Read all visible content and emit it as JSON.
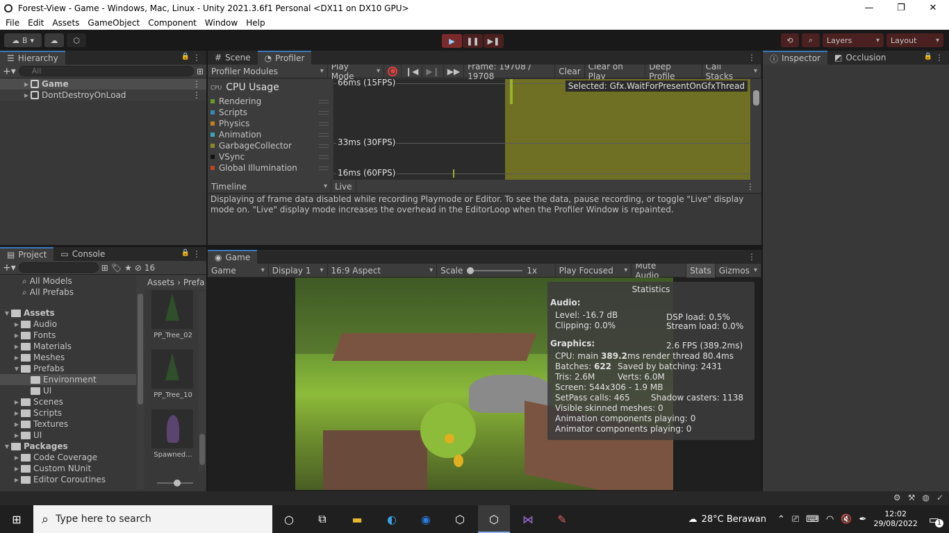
{
  "window": {
    "title": "Forest-View - Game - Windows, Mac, Linux - Unity 2021.3.6f1 Personal <DX11 on DX10 GPU>",
    "minimize": "—",
    "maximize": "❐",
    "close": "✕"
  },
  "menu": [
    "File",
    "Edit",
    "Assets",
    "GameObject",
    "Component",
    "Window",
    "Help"
  ],
  "toolbar": {
    "account": "B",
    "layers": "Layers",
    "layout": "Layout"
  },
  "hierarchy": {
    "tab": "Hierarchy",
    "search_placeholder": "All",
    "items": [
      {
        "label": "Game",
        "selected": true
      },
      {
        "label": "DontDestroyOnLoad",
        "selected": false
      }
    ]
  },
  "scene_tab": "Scene",
  "profiler": {
    "tab": "Profiler",
    "modules": "Profiler Modules",
    "play_mode": "Play Mode",
    "frame": "Frame: 19708 / 19708",
    "clear": "Clear",
    "clear_on_play": "Clear on Play",
    "deep_profile": "Deep Profile",
    "call_stacks": "Call Stacks",
    "cpu_title": "CPU Usage",
    "legend": [
      {
        "label": "Rendering",
        "color": "#6b9a27"
      },
      {
        "label": "Scripts",
        "color": "#3a87b8"
      },
      {
        "label": "Physics",
        "color": "#c6811e"
      },
      {
        "label": "Animation",
        "color": "#3aa5b8"
      },
      {
        "label": "GarbageCollector",
        "color": "#8a8a2a"
      },
      {
        "label": "VSync",
        "color": "#111111"
      },
      {
        "label": "Global Illumination",
        "color": "#b8461e"
      }
    ],
    "grid_labels": [
      "66ms (15FPS)",
      "33ms (30FPS)",
      "16ms (60FPS)"
    ],
    "selected": "Selected: Gfx.WaitForPresentOnGfxThread",
    "timeline": "Timeline",
    "live": "Live",
    "message": "Displaying of frame data disabled while recording Playmode or Editor. To see the data, pause recording, or toggle \"Live\" display mode on. \"Live\" display mode increases the overhead in the EditorLoop when the Profiler Window is repainted."
  },
  "inspector": {
    "tab": "Inspector",
    "occlusion_tab": "Occlusion"
  },
  "project": {
    "tab": "Project",
    "console_tab": "Console",
    "hidden_count": "16",
    "favorites": [
      "All Models",
      "All Prefabs"
    ],
    "tree": [
      {
        "label": "Assets",
        "level": 0,
        "bold": true,
        "expanded": true
      },
      {
        "label": "Audio",
        "level": 1
      },
      {
        "label": "Fonts",
        "level": 1
      },
      {
        "label": "Materials",
        "level": 1
      },
      {
        "label": "Meshes",
        "level": 1
      },
      {
        "label": "Prefabs",
        "level": 1,
        "expanded": true
      },
      {
        "label": "Environment",
        "level": 2,
        "selected": true
      },
      {
        "label": "UI",
        "level": 2
      },
      {
        "label": "Scenes",
        "level": 1
      },
      {
        "label": "Scripts",
        "level": 1
      },
      {
        "label": "Textures",
        "level": 1
      },
      {
        "label": "UI",
        "level": 1
      },
      {
        "label": "Packages",
        "level": 0,
        "bold": true,
        "expanded": true
      },
      {
        "label": "Code Coverage",
        "level": 1
      },
      {
        "label": "Custom NUnit",
        "level": 1
      },
      {
        "label": "Editor Coroutines",
        "level": 1
      }
    ],
    "breadcrumb": [
      "Assets",
      "Prefa"
    ],
    "assets": [
      "PP_Tree_02",
      "PP_Tree_10",
      "Spawned..."
    ]
  },
  "game": {
    "tab": "Game",
    "mode": "Game",
    "display": "Display 1",
    "aspect": "16:9 Aspect",
    "scale_label": "Scale",
    "scale_value": "1x",
    "play_focused": "Play Focused",
    "mute_audio": "Mute Audio",
    "stats": "Stats",
    "gizmos": "Gizmos"
  },
  "statistics": {
    "title": "Statistics",
    "audio_header": "Audio:",
    "level": "Level: -16.7 dB",
    "clipping": "Clipping: 0.0%",
    "dsp": "DSP load: 0.5%",
    "stream": "Stream load: 0.0%",
    "graphics_header": "Graphics:",
    "fps": "2.6 FPS (389.2ms)",
    "cpu_main_prefix": "CPU: main ",
    "cpu_main_value": "389.2",
    "cpu_main_suffix": "ms  render thread 80.4ms",
    "batches_prefix": "Batches: ",
    "batches_value": "622",
    "saved_batching": "Saved by batching: 2431",
    "tris": "Tris: 2.6M",
    "verts": "Verts: 6.0M",
    "screen": "Screen: 544x306 - 1.9 MB",
    "setpass": "SetPass calls: 465",
    "shadow": "Shadow casters: 1138",
    "skinned": "Visible skinned meshes: 0",
    "anim": "Animation components playing: 0",
    "animator": "Animator components playing: 0"
  },
  "taskbar": {
    "search_placeholder": "Type here to search",
    "weather": "28°C  Berawan",
    "time": "12:02",
    "date": "29/08/2022",
    "notifications": "1"
  }
}
